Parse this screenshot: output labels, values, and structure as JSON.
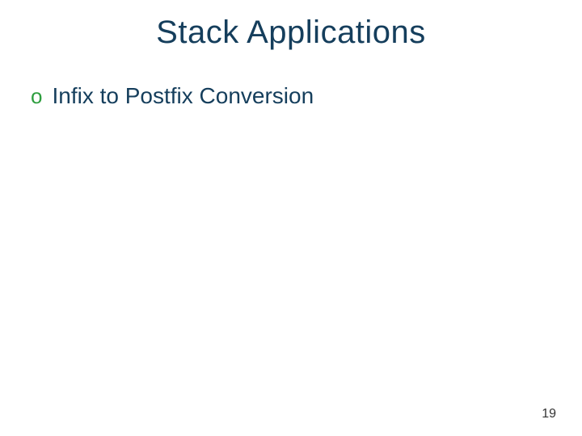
{
  "slide": {
    "title": "Stack Applications",
    "bullets": [
      {
        "marker": "o",
        "text": "Infix to Postfix Conversion"
      }
    ],
    "page_number": "19"
  }
}
